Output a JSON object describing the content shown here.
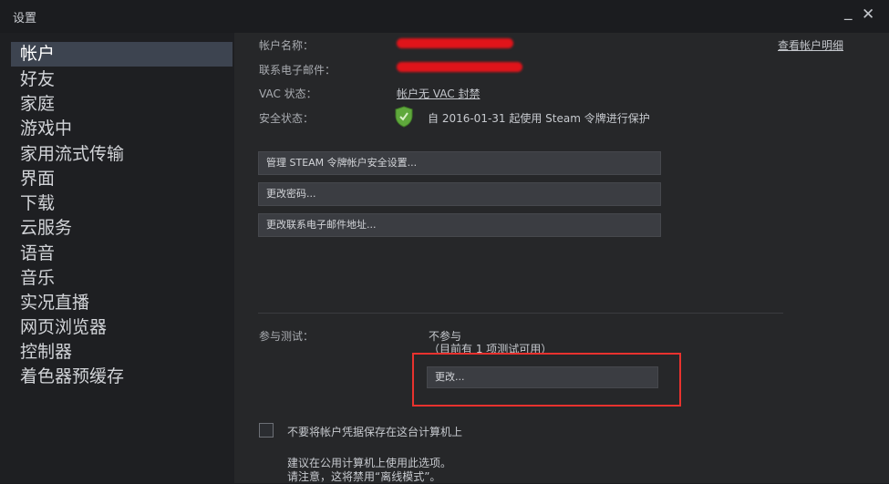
{
  "window": {
    "title": "设置"
  },
  "sidebar": {
    "items": [
      {
        "label": "帐户"
      },
      {
        "label": "好友"
      },
      {
        "label": "家庭"
      },
      {
        "label": "游戏中"
      },
      {
        "label": "家用流式传输"
      },
      {
        "label": "界面"
      },
      {
        "label": "下载"
      },
      {
        "label": "云服务"
      },
      {
        "label": "语音"
      },
      {
        "label": "音乐"
      },
      {
        "label": "实况直播"
      },
      {
        "label": "网页浏览器"
      },
      {
        "label": "控制器"
      },
      {
        "label": "着色器预缓存"
      }
    ],
    "active_index": 0
  },
  "account": {
    "name_label": "帐户名称：",
    "email_label": "联系电子邮件：",
    "vac_label": "VAC 状态：",
    "vac_value": "帐户无 VAC 封禁",
    "security_label": "安全状态：",
    "security_value": "自 2016-01-31 起使用 Steam 令牌进行保护",
    "view_details_link": "查看帐户明细"
  },
  "buttons": {
    "manage_guard": "管理 STEAM 令牌帐户安全设置...",
    "change_password": "更改密码...",
    "change_email": "更改联系电子邮件地址..."
  },
  "beta": {
    "label": "参与测试：",
    "status": "不参与",
    "available": "（目前有 1 项测试可用）",
    "change_button": "更改..."
  },
  "credentials": {
    "checkbox_label": "不要将帐户凭据保存在这台计算机上",
    "checked": false,
    "note_line1": "建议在公用计算机上使用此选项。",
    "note_line2": "请注意，这将禁用“离线模式”。"
  },
  "colors": {
    "highlight": "#e8322e",
    "redaction": "#e0141a",
    "shield": "#5fa83c"
  }
}
